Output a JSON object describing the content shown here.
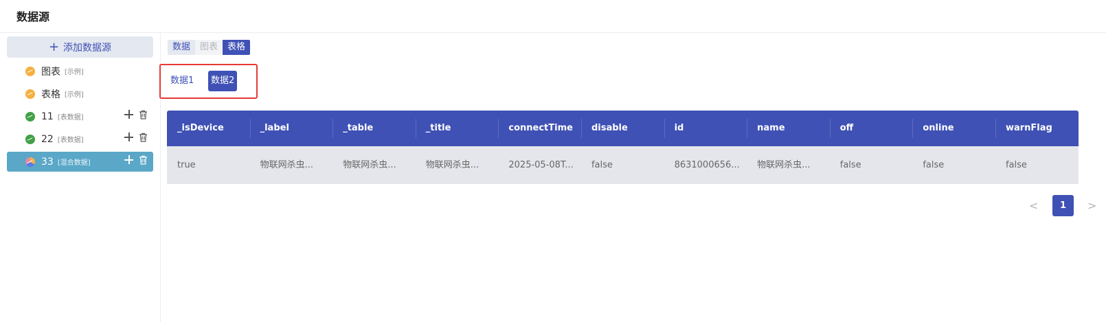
{
  "header": {
    "title": "数据源"
  },
  "sidebar": {
    "add_label": "添加数据源",
    "items": [
      {
        "name": "图表",
        "tag": "[示例]"
      },
      {
        "name": "表格",
        "tag": "[示例]"
      },
      {
        "name": "11",
        "tag": "[表数据]"
      },
      {
        "name": "22",
        "tag": "[表数据]"
      },
      {
        "name": "33",
        "tag": "[混合数据]"
      }
    ]
  },
  "main": {
    "view_tabs": [
      "数据",
      "图表",
      "表格"
    ],
    "sub_tabs": [
      "数据1",
      "数据2"
    ],
    "table": {
      "columns": [
        "_isDevice",
        "_label",
        "_table",
        "_title",
        "connectTime",
        "disable",
        "id",
        "name",
        "off",
        "online",
        "warnFlag"
      ],
      "rows": [
        [
          "true",
          "物联网杀虫...",
          "物联网杀虫...",
          "物联网杀虫...",
          "2025-05-08T...",
          "false",
          "8631000656...",
          "物联网杀虫...",
          "false",
          "false",
          "false"
        ]
      ]
    },
    "pagination": {
      "current": "1",
      "prev": "<",
      "next": ">"
    }
  },
  "colors": {
    "primary": "#3f51b5",
    "active_item": "#5aa7c7",
    "highlight_border": "#e53935"
  }
}
